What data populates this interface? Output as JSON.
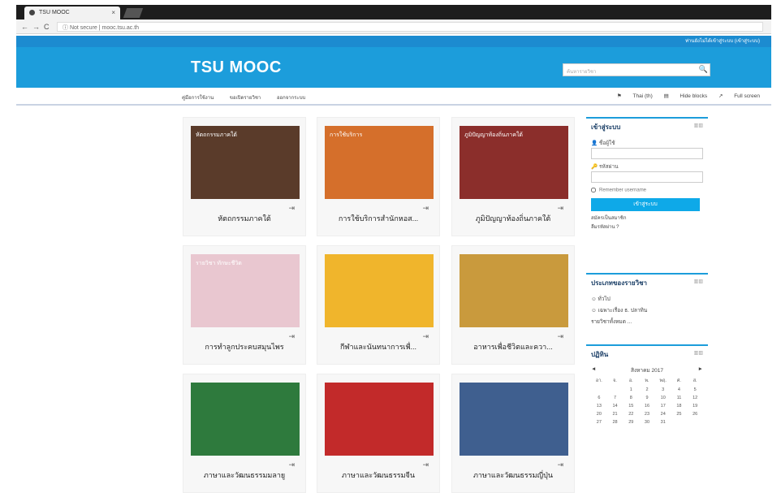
{
  "browser": {
    "tab_title": "TSU MOOC",
    "tab_close": "×",
    "security": "Not secure",
    "url": "mooc.tsu.ac.th"
  },
  "site": {
    "top_login_link": "ท่านยังไม่ได้เข้าสู่ระบบ (เข้าสู่ระบบ)",
    "logo": "TSU MOOC",
    "search_placeholder": "ค้นหารายวิชา",
    "nav": [
      "คู่มือการใช้งาน",
      "ขอเปิดรายวิชา",
      "ออกจากระบบ"
    ],
    "lang": "Thai (th)",
    "hide_blocks": "Hide blocks",
    "full_screen": "Full screen"
  },
  "courses": [
    {
      "title": "หัตถกรรมภาคใต้",
      "img_text": "หัตถกรรมภาคใต้",
      "bg": "#5a3b2a"
    },
    {
      "title": "การใช้บริการสำนักหอส...",
      "img_text": "การใช้บริการ",
      "bg": "#d56f2b"
    },
    {
      "title": "ภูมิปัญญาท้องถิ่นภาคใต้",
      "img_text": "ภูมิปัญญาท้องถิ่นภาคใต้",
      "bg": "#8b2e2b"
    },
    {
      "title": "การทำลูกประคบสมุนไพร",
      "img_text": "รายวิชา ทักษะชีวิต",
      "bg": "#e9c7d0"
    },
    {
      "title": "กีฬาและนันทนาการเพื่...",
      "img_text": "",
      "bg": "#f0b52c"
    },
    {
      "title": "อาหารเพื่อชีวิตและควา...",
      "img_text": "",
      "bg": "#c99a3d"
    },
    {
      "title": "ภาษาและวัฒนธรรมมลายู",
      "img_text": "",
      "bg": "#2e7a3d"
    },
    {
      "title": "ภาษาและวัฒนธรรมจีน",
      "img_text": "",
      "bg": "#c22a2a"
    },
    {
      "title": "ภาษาและวัฒนธรรมญี่ปุ่น",
      "img_text": "",
      "bg": "#3f5f8f"
    }
  ],
  "login_panel": {
    "title": "เข้าสู่ระบบ",
    "username_label": "ชื่อผู้ใช้",
    "password_label": "รหัสผ่าน",
    "remember": "Remember username",
    "login_button": "เข้าสู่ระบบ",
    "signup": "สมัครเป็นสมาชิก",
    "forgot": "ลืมรหัสผ่าน ?"
  },
  "categories_panel": {
    "title": "ประเภทของรายวิชา",
    "items": [
      "ทั่วไป",
      "เฉพาะเรื่อง ธ. ปลาทิน",
      "รายวิชาทั้งหมด ..."
    ]
  },
  "calendar_panel": {
    "title": "ปฏิทิน",
    "month": "สิงหาคม 2017",
    "prev": "◄",
    "next": "►",
    "days": [
      "อา.",
      "จ.",
      "อ.",
      "พ.",
      "พฤ.",
      "ศ.",
      "ส."
    ],
    "dates": [
      "",
      "",
      "1",
      "2",
      "3",
      "4",
      "5",
      "6",
      "7",
      "8",
      "9",
      "10",
      "11",
      "12",
      "13",
      "14",
      "15",
      "16",
      "17",
      "18",
      "19",
      "20",
      "21",
      "22",
      "23",
      "24",
      "25",
      "26",
      "27",
      "28",
      "29",
      "30",
      "31",
      "",
      ""
    ]
  }
}
